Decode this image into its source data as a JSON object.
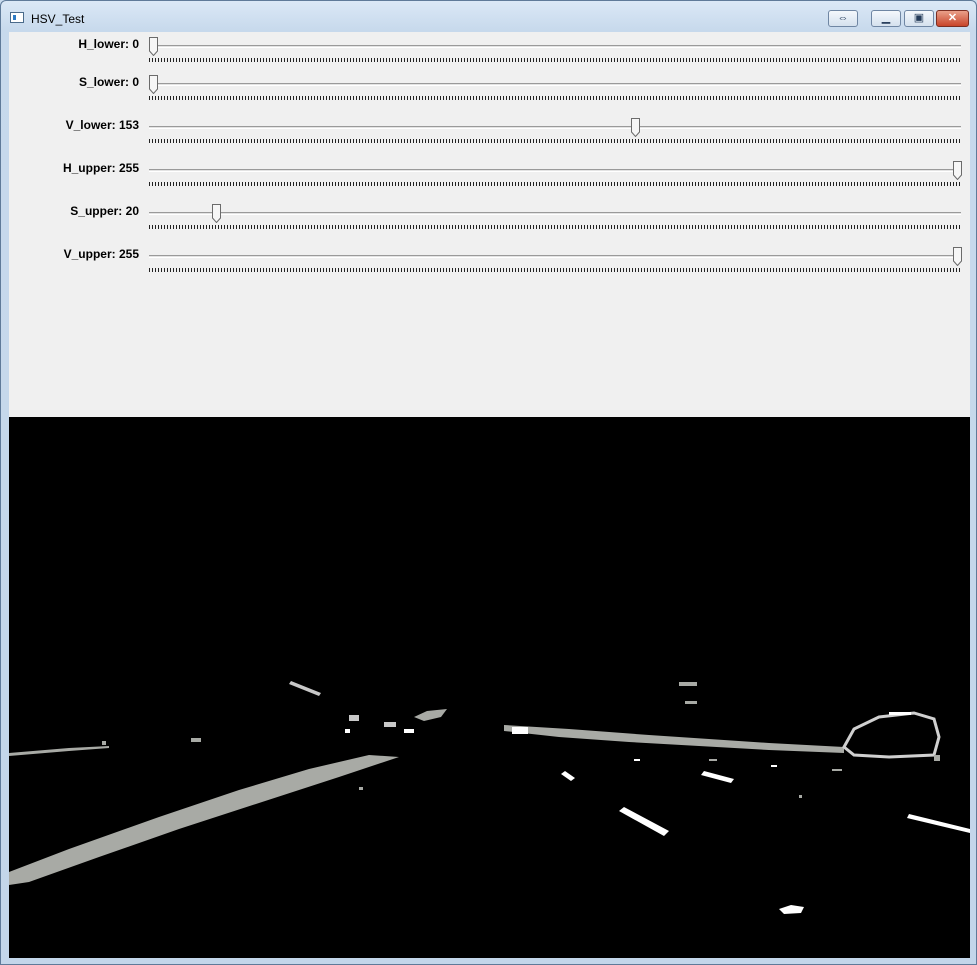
{
  "window": {
    "title": "HSV_Test",
    "titlebar_buttons": [
      {
        "name": "restore-arrows-button",
        "icon": "double-arrow-icon",
        "glyph": "⇔"
      },
      {
        "name": "minimize-button",
        "icon": "minimize-icon",
        "glyph": "▁"
      },
      {
        "name": "maximize-button",
        "icon": "maximize-icon",
        "glyph": "▣"
      },
      {
        "name": "close-button",
        "icon": "close-icon",
        "glyph": "✕"
      }
    ]
  },
  "trackbars": [
    {
      "label": "H_lower: 0",
      "value": 0,
      "max": 255
    },
    {
      "label": "S_lower: 0",
      "value": 0,
      "max": 255
    },
    {
      "label": "V_lower: 153",
      "value": 153,
      "max": 255
    },
    {
      "label": "H_upper: 255",
      "value": 255,
      "max": 255
    },
    {
      "label": "S_upper: 20",
      "value": 20,
      "max": 255
    },
    {
      "label": "V_upper: 255",
      "value": 255,
      "max": 255
    }
  ],
  "image": {
    "description_icon": "binary-mask-image",
    "colors": {
      "background": "#000000",
      "lane_line": "#a8aaa5",
      "mask_white": "#ffffff"
    }
  }
}
